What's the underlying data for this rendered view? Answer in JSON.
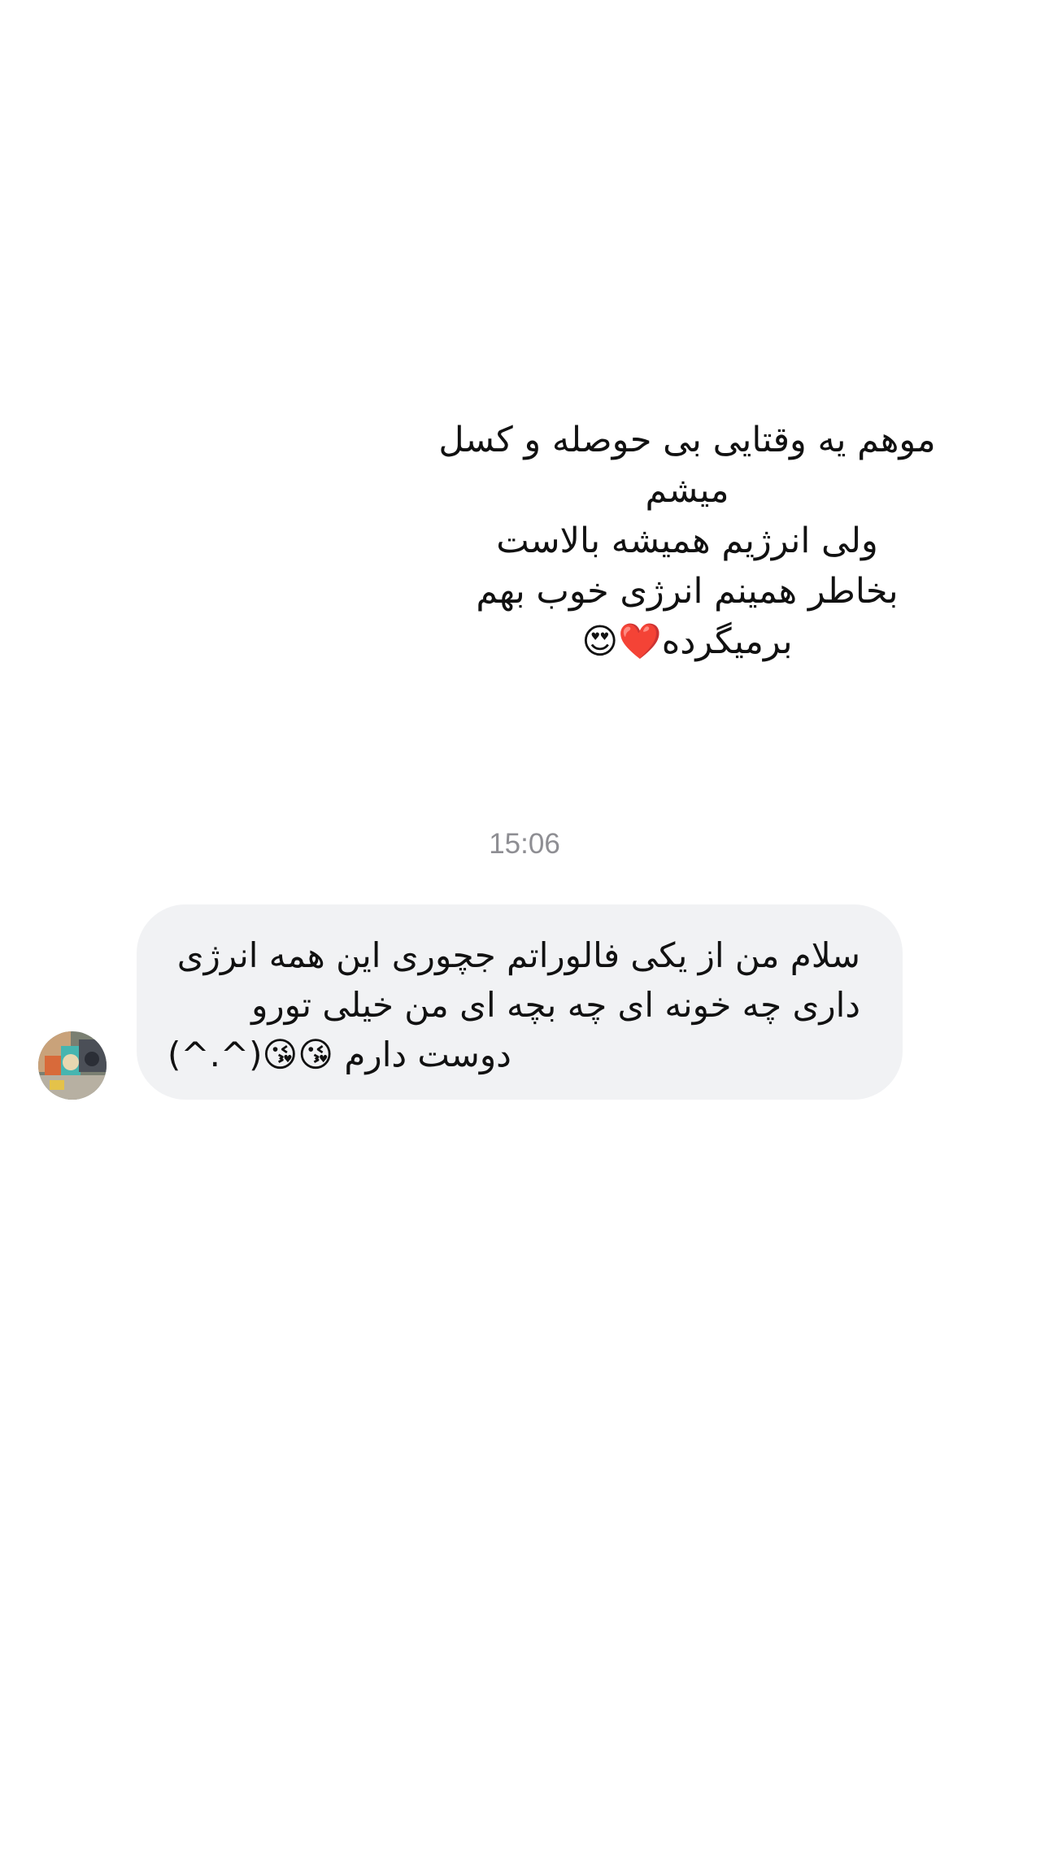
{
  "story_reply_text": {
    "lines": [
      "موهم یه وقتایی بی حوصله و کسل",
      "میشم",
      "ولی انرژیم همیشه بالاست",
      "بخاطر همینم انرژی خوب بهم",
      "برمیگرده❤️😍"
    ]
  },
  "timestamp": "15:06",
  "message": {
    "lines": [
      "سلام من از یکی فالوراتم جچوری این همه انرژی",
      "داری چه خونه ای چه بچه ای من خیلی تورو",
      "دوست دارم 😘😘(^.^)"
    ]
  },
  "avatar": {
    "icon": "profile-photo"
  }
}
